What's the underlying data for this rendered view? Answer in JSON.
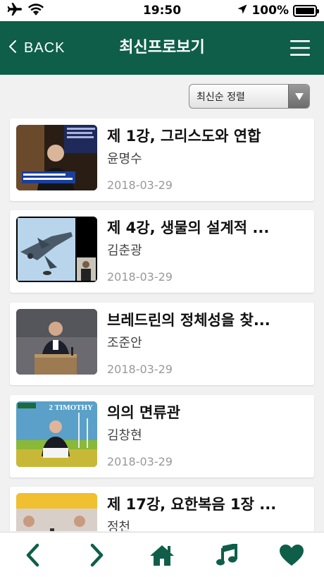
{
  "status_bar": {
    "time": "19:50",
    "battery": "100%",
    "icons": [
      "airplane-icon",
      "wifi-icon",
      "location-arrow-icon",
      "battery-icon"
    ]
  },
  "nav": {
    "back_label": "BACK",
    "title": "최신프로보기",
    "menu_icon": "hamburger-menu-icon"
  },
  "sort": {
    "selected": "최신순 정렬"
  },
  "videos": [
    {
      "title": "제 1강, 그리스도와 연합",
      "author": "윤명수",
      "date": "2018-03-29"
    },
    {
      "title": "제 4강, 생물의 설계적 ...",
      "author": "김춘광",
      "date": "2018-03-29"
    },
    {
      "title": "브레드린의 정체성을 찾...",
      "author": "조준안",
      "date": "2018-03-29"
    },
    {
      "title": "의의 면류관",
      "author": "김창현",
      "date": "2018-03-29"
    },
    {
      "title": "제 17강, 요한복음 1장 ...",
      "author": "정천",
      "date": ""
    }
  ],
  "thumb_text": {
    "v4_series": "2 TIMOTHY"
  },
  "tab_bar": {
    "items": [
      "back-arrow-icon",
      "forward-arrow-icon",
      "home-icon",
      "music-note-icon",
      "heart-icon"
    ]
  },
  "colors": {
    "brand": "#0f5e49",
    "background": "#f1f1f1"
  }
}
